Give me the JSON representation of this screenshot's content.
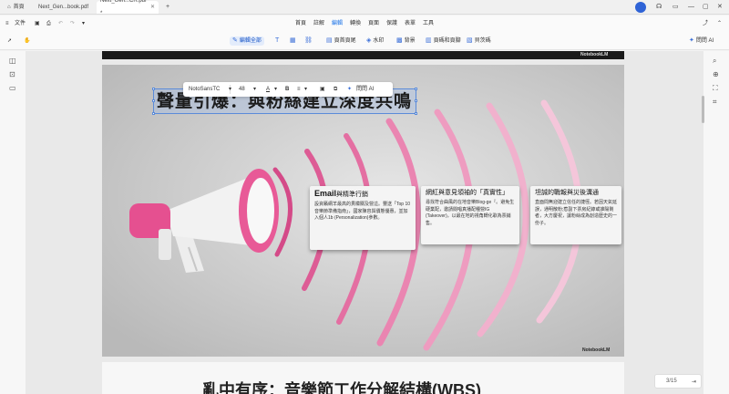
{
  "titlebar": {
    "home_label": "首頁",
    "tabs": [
      {
        "label": "Next_Gen...book.pdf"
      },
      {
        "label": "Next_Gen...CR.pdf *"
      }
    ],
    "new_tab": "+"
  },
  "menubar": {
    "file_label": "文件",
    "items": [
      "首頁",
      "註解",
      "編輯",
      "轉換",
      "頁面",
      "保護",
      "表單",
      "工具"
    ],
    "active_item": "編輯"
  },
  "toolbar": {
    "edit_all": "編輯全部",
    "items": [
      "頁首頁尾",
      "水印",
      "背景",
      "頁碼和頁腳",
      "貝茨碼"
    ],
    "ask_ai": "問問 AI"
  },
  "format_bar": {
    "font": "NotoSansTC",
    "size": "48",
    "ask_ai": "問問 AI"
  },
  "slide": {
    "title": "聲量引爆：與粉絲建立深度共鳴",
    "watermark": "NotebookLM",
    "cards": [
      {
        "title_bold": "Email",
        "title_rest": "與精準行銷",
        "body": "設資籟網羊最高的貫檬關及營這。豐送「Top 10音樂節準備指南」，國家陳容與價態優惠，並加入個人1b (Personalization)參數。"
      },
      {
        "title_bold": "",
        "title_rest": "網紅與意見領袖的「真實性」",
        "body": "尋找符合曲風的在地音樂Blog-ge『。避免生硬業配，邀請閱唱真播配種營IG (Takeover)，以最在地的視角轉化歌為票銷售。"
      },
      {
        "title_bold": "",
        "title_rest": "坦誠的戰報與災後溝通",
        "body": "直面問無迎建立信任的捷徑。若因天氣延誤，通明散粉;惹副下票房紀錄或誰陽剩者，大方慶祝，讓粉絲成為創造歷史的一份子。"
      }
    ],
    "next_title": "亂中有序：音樂節工作分解結構(WBS)"
  },
  "pager": {
    "text": "3/15"
  },
  "colors": {
    "accent": "#1a73e8",
    "selection": "#5b8bd9",
    "pink": "#e0528e"
  }
}
